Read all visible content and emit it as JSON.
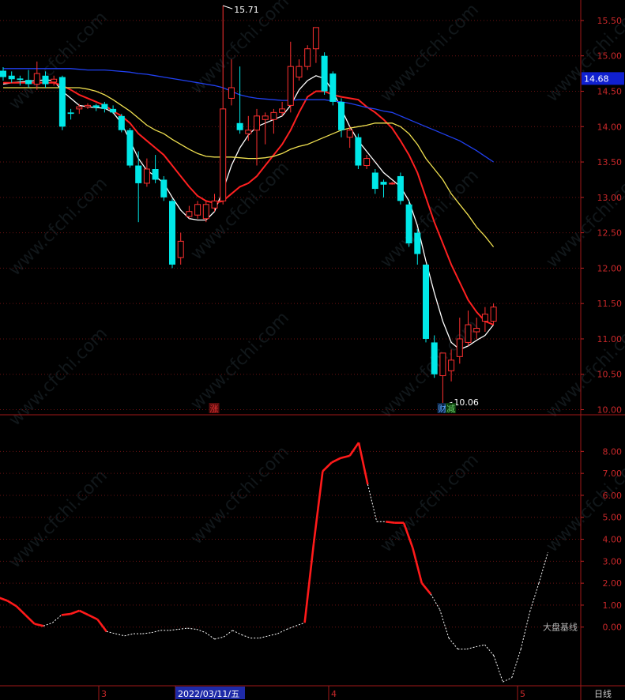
{
  "chart_data": [
    {
      "type": "candlestick",
      "ylim": [
        9.95,
        15.7
      ],
      "yticks": [
        "15.50",
        "15.00",
        "14.50",
        "14.00",
        "13.50",
        "13.00",
        "12.50",
        "12.00",
        "11.50",
        "11.00",
        "10.50",
        "10.00"
      ],
      "price_tag": "14.68",
      "high_label": "15.71",
      "low_label": "10.06",
      "markers": [
        {
          "text": "涨",
          "color": "#e03030",
          "bg": "#5a0d0d",
          "bar": 25
        },
        {
          "text": "财",
          "color": "#5aa8ff",
          "bg": "#0a2345",
          "bar": 52
        },
        {
          "text": "减",
          "color": "#6ad06a",
          "bg": "#0c3a0c",
          "bar": 53
        }
      ],
      "candles": [
        [
          14.79,
          14.7,
          14.84,
          14.65
        ],
        [
          14.72,
          14.67,
          14.78,
          14.62
        ],
        [
          14.68,
          14.66,
          14.72,
          14.58
        ],
        [
          14.66,
          14.6,
          14.8,
          14.55
        ],
        [
          14.6,
          14.75,
          14.92,
          14.52
        ],
        [
          14.72,
          14.6,
          14.78,
          14.55
        ],
        [
          14.63,
          14.67,
          14.72,
          14.58
        ],
        [
          14.7,
          14.0,
          14.72,
          13.95
        ],
        [
          14.2,
          14.18,
          14.25,
          14.1
        ],
        [
          14.25,
          14.28,
          14.32,
          14.18
        ],
        [
          14.28,
          14.3,
          14.33,
          14.25
        ],
        [
          14.3,
          14.27,
          14.32,
          14.22
        ],
        [
          14.32,
          14.25,
          14.35,
          14.2
        ],
        [
          14.25,
          14.2,
          14.3,
          14.18
        ],
        [
          14.15,
          13.95,
          14.18,
          13.92
        ],
        [
          13.95,
          13.45,
          13.98,
          13.42
        ],
        [
          13.45,
          13.2,
          13.65,
          12.65
        ],
        [
          13.2,
          13.4,
          13.55,
          13.15
        ],
        [
          13.4,
          13.25,
          13.6,
          13.2
        ],
        [
          13.25,
          13.0,
          13.3,
          12.95
        ],
        [
          12.95,
          12.05,
          12.98,
          12.0
        ],
        [
          12.15,
          12.38,
          12.5,
          12.05
        ],
        [
          12.73,
          12.8,
          12.88,
          12.7
        ],
        [
          12.75,
          12.9,
          12.95,
          12.7
        ],
        [
          12.7,
          12.9,
          12.95,
          12.65
        ],
        [
          12.85,
          12.95,
          13.05,
          12.8
        ],
        [
          12.95,
          14.25,
          15.71,
          12.9
        ],
        [
          14.4,
          14.55,
          14.95,
          14.3
        ],
        [
          14.05,
          13.95,
          14.85,
          13.9
        ],
        [
          13.9,
          13.95,
          14.15,
          13.8
        ],
        [
          13.95,
          14.15,
          14.25,
          13.45
        ],
        [
          14.1,
          14.15,
          14.2,
          13.75
        ],
        [
          14.1,
          14.2,
          14.25,
          13.9
        ],
        [
          14.2,
          14.25,
          14.35,
          14.15
        ],
        [
          14.3,
          14.85,
          15.2,
          14.2
        ],
        [
          14.7,
          14.85,
          14.95,
          14.65
        ],
        [
          14.85,
          15.1,
          15.15,
          14.8
        ],
        [
          15.1,
          15.4,
          15.4,
          14.9
        ],
        [
          15.0,
          14.5,
          15.05,
          14.45
        ],
        [
          14.75,
          14.35,
          14.78,
          14.3
        ],
        [
          14.35,
          13.95,
          14.4,
          13.85
        ],
        [
          13.85,
          13.95,
          14.0,
          13.7
        ],
        [
          13.85,
          13.45,
          13.9,
          13.4
        ],
        [
          13.45,
          13.55,
          13.6,
          13.4
        ],
        [
          13.35,
          13.12,
          13.4,
          13.05
        ],
        [
          13.22,
          13.18,
          13.25,
          13.0
        ],
        [
          13.2,
          13.2,
          13.22,
          13.18
        ],
        [
          13.3,
          12.95,
          13.35,
          12.9
        ],
        [
          12.9,
          12.35,
          12.95,
          12.3
        ],
        [
          12.5,
          12.2,
          12.55,
          12.05
        ],
        [
          12.05,
          11.0,
          12.05,
          10.95
        ],
        [
          10.95,
          10.5,
          11.05,
          10.45
        ],
        [
          10.48,
          10.8,
          10.8,
          10.06
        ],
        [
          10.55,
          10.7,
          10.85,
          10.4
        ],
        [
          10.75,
          11.0,
          11.3,
          10.65
        ],
        [
          10.95,
          11.2,
          11.4,
          10.9
        ],
        [
          11.1,
          11.15,
          11.3,
          11.0
        ],
        [
          11.25,
          11.35,
          11.45,
          11.1
        ],
        [
          11.25,
          11.45,
          11.5,
          11.2
        ]
      ],
      "ma_lines": [
        {
          "color": "#ffffff",
          "values": [
            14.6,
            14.62,
            14.63,
            14.64,
            14.65,
            14.66,
            14.65,
            14.5,
            14.4,
            14.3,
            14.28,
            14.27,
            14.26,
            14.2,
            14.05,
            13.8,
            13.55,
            13.38,
            13.3,
            13.2,
            13.0,
            12.82,
            12.7,
            12.68,
            12.68,
            12.8,
            13.1,
            13.45,
            13.7,
            13.88,
            14.0,
            14.05,
            14.1,
            14.15,
            14.3,
            14.52,
            14.65,
            14.72,
            14.68,
            14.5,
            14.25,
            14.0,
            13.8,
            13.65,
            13.5,
            13.35,
            13.25,
            13.15,
            12.95,
            12.6,
            12.1,
            11.65,
            11.25,
            10.95,
            10.85,
            10.9,
            10.98,
            11.05,
            11.2
          ]
        },
        {
          "color": "#ff2020",
          "values": [
            14.62,
            14.62,
            14.62,
            14.62,
            14.62,
            14.62,
            14.62,
            14.58,
            14.52,
            14.45,
            14.4,
            14.35,
            14.3,
            14.22,
            14.15,
            14.05,
            13.9,
            13.8,
            13.7,
            13.6,
            13.45,
            13.3,
            13.15,
            13.02,
            12.95,
            12.92,
            12.95,
            13.05,
            13.15,
            13.2,
            13.3,
            13.45,
            13.6,
            13.75,
            13.95,
            14.2,
            14.42,
            14.5,
            14.5,
            14.45,
            14.42,
            14.4,
            14.38,
            14.28,
            14.2,
            14.1,
            13.98,
            13.8,
            13.6,
            13.35,
            13.0,
            12.65,
            12.35,
            12.05,
            11.8,
            11.55,
            11.38,
            11.25,
            11.2
          ]
        },
        {
          "color": "#f0e050",
          "values": [
            14.55,
            14.55,
            14.55,
            14.55,
            14.55,
            14.55,
            14.55,
            14.55,
            14.55,
            14.55,
            14.53,
            14.5,
            14.45,
            14.38,
            14.3,
            14.22,
            14.12,
            14.02,
            13.95,
            13.9,
            13.82,
            13.75,
            13.68,
            13.62,
            13.58,
            13.57,
            13.57,
            13.57,
            13.56,
            13.55,
            13.55,
            13.56,
            13.58,
            13.62,
            13.68,
            13.72,
            13.75,
            13.8,
            13.85,
            13.9,
            13.95,
            13.98,
            14.0,
            14.02,
            14.05,
            14.05,
            14.05,
            14.0,
            13.9,
            13.75,
            13.55,
            13.4,
            13.25,
            13.05,
            12.9,
            12.75,
            12.58,
            12.45,
            12.3
          ]
        },
        {
          "color": "#2040f0",
          "values": [
            14.82,
            14.82,
            14.82,
            14.82,
            14.82,
            14.82,
            14.82,
            14.82,
            14.82,
            14.81,
            14.8,
            14.8,
            14.8,
            14.79,
            14.78,
            14.77,
            14.75,
            14.74,
            14.72,
            14.7,
            14.68,
            14.66,
            14.64,
            14.62,
            14.6,
            14.58,
            14.55,
            14.5,
            14.45,
            14.42,
            14.4,
            14.39,
            14.38,
            14.37,
            14.37,
            14.38,
            14.38,
            14.38,
            14.38,
            14.36,
            14.35,
            14.33,
            14.3,
            14.27,
            14.25,
            14.22,
            14.2,
            14.15,
            14.1,
            14.05,
            14.0,
            13.95,
            13.9,
            13.85,
            13.8,
            13.73,
            13.66,
            13.58,
            13.5
          ]
        }
      ]
    },
    {
      "type": "line",
      "ylim": [
        -2.6,
        9.2
      ],
      "yticks": [
        "8.00",
        "7.00",
        "6.00",
        "5.00",
        "4.00",
        "3.00",
        "2.00",
        "1.00",
        "0.00"
      ],
      "baseline_label": "大盘基线",
      "series": [
        {
          "values": [
            1.35,
            1.2,
            0.95,
            0.55,
            0.15,
            0.05,
            0.2,
            0.55,
            0.6,
            0.75,
            0.55,
            0.35,
            -0.2,
            -0.3,
            -0.4,
            -0.3,
            -0.3,
            -0.25,
            -0.15,
            -0.15,
            -0.1,
            -0.05,
            -0.1,
            -0.25,
            -0.55,
            -0.45,
            -0.15,
            -0.35,
            -0.5,
            -0.5,
            -0.4,
            -0.3,
            -0.1,
            0.05,
            0.2,
            3.8,
            7.1,
            7.5,
            7.7,
            7.8,
            8.4,
            6.5,
            4.8,
            4.8,
            4.75,
            4.75,
            3.6,
            2.0,
            1.5,
            0.8,
            -0.5,
            -1.0,
            -1.0,
            -0.9,
            -0.8,
            -1.3,
            -2.5,
            -2.3,
            -1.0,
            0.7,
            2.0,
            3.4
          ],
          "colors": "rrrrrwwrrrrrwwwwwwwwwwwwwwwwwwwwwwrrrrrrrwwrrrrrwwwwwwwwwwwwwwwwrrr"
        }
      ]
    }
  ],
  "xaxis": {
    "labels": [
      "3",
      "2022/03/11/五",
      "4",
      "5"
    ],
    "highlight": "2022/03/11/五"
  },
  "period_label": "日线"
}
